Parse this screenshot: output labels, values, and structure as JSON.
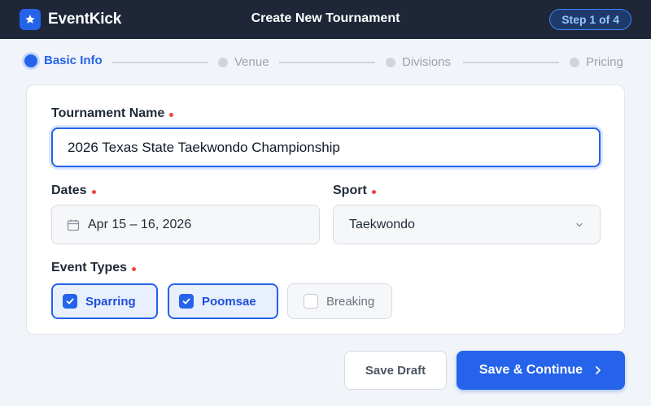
{
  "app": {
    "name": "EventKick",
    "page_title": "Create New Tournament",
    "step_badge": "Step 1 of 4"
  },
  "stepper": {
    "steps": [
      {
        "label": "Basic Info",
        "state": "active"
      },
      {
        "label": "Venue",
        "state": "pending"
      },
      {
        "label": "Divisions",
        "state": "pending"
      },
      {
        "label": "Pricing",
        "state": "pending"
      }
    ]
  },
  "form": {
    "tournament_name": {
      "label": "Tournament Name",
      "value": "2026 Texas State Taekwondo Championship",
      "required": true
    },
    "dates": {
      "label": "Dates",
      "value": "Apr 15 – 16, 2026",
      "icon": "calendar-icon",
      "required": true
    },
    "sport": {
      "label": "Sport",
      "value": "Taekwondo",
      "icon": "chevron-down-icon",
      "required": true
    },
    "event_types": {
      "label": "Event Types",
      "required": true,
      "options": [
        {
          "label": "Sparring",
          "checked": true
        },
        {
          "label": "Poomsae",
          "checked": true
        },
        {
          "label": "Breaking",
          "checked": false
        }
      ]
    }
  },
  "actions": {
    "save_draft": "Save Draft",
    "save_continue": "Save & Continue"
  },
  "colors": {
    "accent": "#2563eb",
    "header_bg": "#1e2638",
    "required": "#ef4444"
  }
}
